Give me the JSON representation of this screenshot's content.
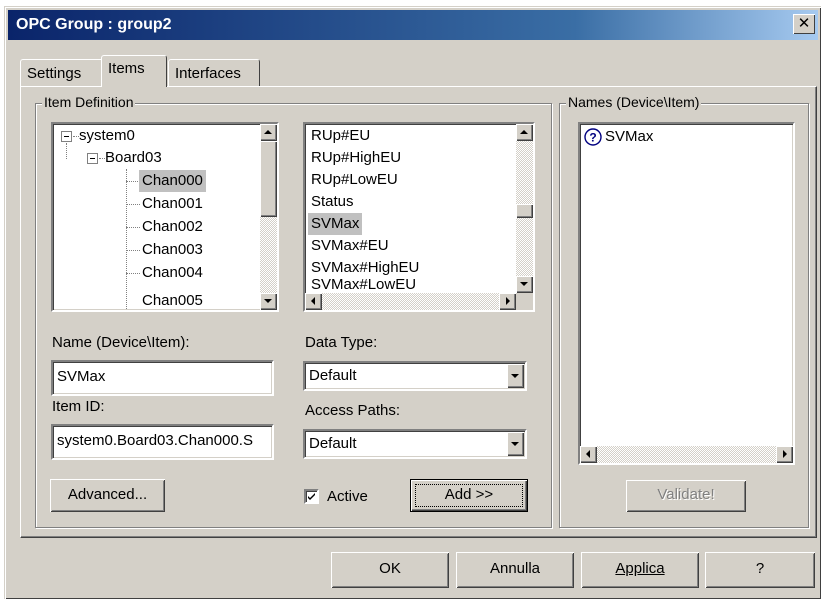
{
  "window": {
    "title": "OPC Group : group2",
    "close_glyph": "✕"
  },
  "tabs": [
    {
      "label": "Settings"
    },
    {
      "label": "Items"
    },
    {
      "label": "Interfaces"
    }
  ],
  "item_definition": {
    "legend": "Item Definition",
    "tree": [
      {
        "label": "system0"
      },
      {
        "label": "Board03"
      },
      {
        "label": "Chan000"
      },
      {
        "label": "Chan001"
      },
      {
        "label": "Chan002"
      },
      {
        "label": "Chan003"
      },
      {
        "label": "Chan004"
      },
      {
        "label": "Chan005"
      }
    ],
    "items": [
      {
        "label": "RUp#EU"
      },
      {
        "label": "RUp#HighEU"
      },
      {
        "label": "RUp#LowEU"
      },
      {
        "label": "Status"
      },
      {
        "label": "SVMax"
      },
      {
        "label": "SVMax#EU"
      },
      {
        "label": "SVMax#HighEU"
      },
      {
        "label": "SVMax#LowEU"
      }
    ],
    "name_label": "Name (Device\\Item):",
    "name_value": "SVMax",
    "itemid_label": "Item ID:",
    "itemid_value": "system0.Board03.Chan000.S",
    "datatype_label": "Data Type:",
    "datatype_value": "Default",
    "access_label": "Access Paths:",
    "access_value": "Default",
    "advanced_label": "Advanced...",
    "active_label": "Active",
    "active_checked": true,
    "add_label": "Add >>"
  },
  "names_panel": {
    "legend": "Names (Device\\Item)",
    "items": [
      {
        "label": "SVMax",
        "icon": "question-icon"
      }
    ],
    "validate_label": "Validate!"
  },
  "footer": {
    "ok_label": "OK",
    "cancel_label": "Annulla",
    "apply_label": "Applica",
    "help_label": "?"
  }
}
